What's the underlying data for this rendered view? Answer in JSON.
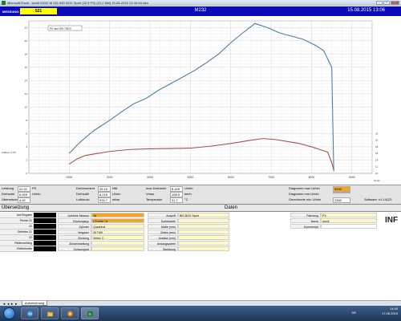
{
  "window": {
    "title": "Microsoft Excel - wordi M232 Ni 521 BIG BOX Sport (22,9 PS) (21,2 NM) 15-08-2015 13-06-54.xlsx",
    "controls": [
      "–",
      "□",
      "×"
    ]
  },
  "header": {
    "messung_label": "MESSUNG:",
    "messung_value": "521",
    "center_title": "M232",
    "date": "15.08.2015 13:06"
  },
  "chart_data": {
    "type": "line",
    "legend_note": "PS nach DIN 70020",
    "y_left_label": "Aufbau: 0 PS",
    "x_ticks": [
      "2000",
      "3000",
      "4000",
      "5000",
      "6000",
      "7000",
      "8000",
      "9000"
    ],
    "x_unit": "U/min",
    "xlim": [
      1000,
      9500
    ],
    "y_left_ticks": [
      "0",
      "2",
      "4",
      "6",
      "8",
      "10",
      "12",
      "14",
      "16",
      "18",
      "20",
      "22"
    ],
    "y_left_lim": [
      0,
      23
    ],
    "y_right_ticks": [
      "10",
      "12",
      "14",
      "16",
      "18",
      "20",
      "22"
    ],
    "y_right_lim": [
      0,
      23
    ],
    "series": [
      {
        "color": "#4a7fae",
        "x": [
          2000,
          2200,
          2400,
          2600,
          2800,
          3000,
          3300,
          3600,
          3900,
          4200,
          4500,
          4800,
          5100,
          5400,
          5700,
          6000,
          6300,
          6600,
          6900,
          7200,
          7500,
          7800,
          8100,
          8300,
          8500,
          8550
        ],
        "y": [
          3.0,
          4.3,
          5.4,
          6.4,
          7.2,
          8.0,
          9.3,
          10.5,
          11.3,
          12.5,
          13.5,
          14.5,
          15.5,
          16.7,
          18.0,
          19.7,
          21.2,
          22.6,
          22.0,
          21.2,
          20.7,
          20.2,
          19.3,
          18.5,
          16.0,
          0.3
        ]
      },
      {
        "color": "#b0504a",
        "x": [
          2000,
          2200,
          2400,
          2700,
          3000,
          3500,
          4000,
          4500,
          5000,
          5500,
          6000,
          6500,
          6800,
          7100,
          7400,
          7700,
          8000,
          8200,
          8400,
          8500,
          8550
        ],
        "y": [
          1.4,
          2.2,
          2.7,
          3.0,
          3.3,
          3.6,
          3.7,
          3.75,
          3.8,
          4.1,
          4.5,
          5.0,
          5.25,
          5.1,
          4.8,
          4.5,
          4.0,
          3.6,
          3.2,
          1.6,
          0.5
        ]
      }
    ]
  },
  "stats": {
    "row1": [
      {
        "label": "Leistung",
        "value": "22.91",
        "unit": "PS"
      },
      {
        "label": "Drehmoment",
        "value": "25.19",
        "unit": "NM"
      },
      {
        "label": "max Drehzahl",
        "value": "8.449",
        "unit": "U/min"
      },
      {
        "label": "Diagramm max U/min",
        "value": "9200"
      }
    ],
    "row2": [
      {
        "label": "Drehzahl",
        "value": "6.929",
        "unit": "U/min"
      },
      {
        "label": "Drehzahl",
        "value": "6.215",
        "unit": "U/min"
      },
      {
        "label": "Vmax",
        "value": "108.5",
        "unit": "km/h"
      },
      {
        "label": "Diagramm min U/min",
        "value": ""
      }
    ],
    "row3": [
      {
        "label": "Übersetzung",
        "value": "4.92",
        "unit": ""
      },
      {
        "label": "Luftdruck",
        "value": "976.7",
        "unit": "mbar"
      },
      {
        "label": "Temperatur",
        "value": "31.7",
        "unit": "°C"
      },
      {
        "label": "Gerechnete min U/min",
        "value": "2300"
      }
    ],
    "software": "Software: v1.14123"
  },
  "bottom": {
    "left_title": "Übersetzung",
    "center_title": "Daten",
    "left_rows": [
      "Ant.Eingabe",
      "Primär 21",
      "22",
      "Getriebe 21",
      "22",
      "Reifenumfang",
      "Reifenbreite"
    ],
    "fields": [
      {
        "label": "Getriebe Messen",
        "value": "JA",
        "style": "orange"
      },
      {
        "label": "Zündungstyp",
        "value": "1 Funke / U",
        "style": "orange"
      },
      {
        "label": "Zylinder",
        "value": "Quadrinol",
        "style": "yellow"
      },
      {
        "label": "Vergaser",
        "value": "30 TMX",
        "style": "yellow"
      },
      {
        "label": "Zündung",
        "value": "Vertex C",
        "style": "yellow"
      },
      {
        "label": "Zündeinstellung",
        "value": "",
        "style": "yellow"
      },
      {
        "label": "Schwungrad",
        "value": "",
        "style": "yellow"
      }
    ],
    "fields2": [
      {
        "label": "Auspuff",
        "value": "BIG BOX Sport"
      },
      {
        "label": "Kurbelwelle",
        "value": ""
      },
      {
        "label": "Maße (mm)",
        "value": ""
      },
      {
        "label": "Zeiten (mm)",
        "value": ""
      },
      {
        "label": "Auslass (mm)",
        "value": ""
      },
      {
        "label": "Ansaugsystem",
        "value": ""
      },
      {
        "label": "Bedüsung",
        "value": ""
      }
    ],
    "fields3": [
      {
        "label": "Fahrzeug",
        "value": "PX"
      },
      {
        "label": "Name",
        "value": "wordi"
      },
      {
        "label": "Kommentar",
        "value": ""
      }
    ],
    "inf": "INF"
  },
  "sheet_tab": {
    "nav": "◄ ◄ ► ►",
    "label": "Aufzeichnung"
  },
  "taskbar": {
    "lang": "DE",
    "time": "14:40",
    "date": "17.08.2015"
  }
}
